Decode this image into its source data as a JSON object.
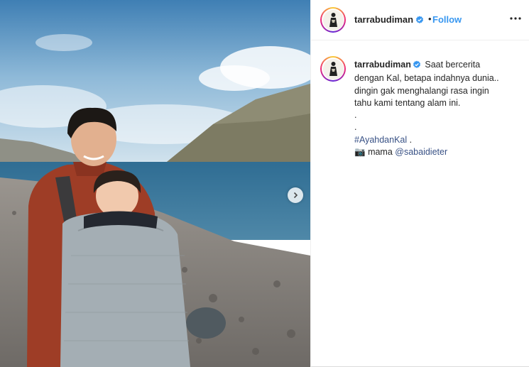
{
  "post": {
    "account": {
      "username": "tarrabudiman",
      "verified": true,
      "follow_label": "Follow",
      "separator": "•"
    },
    "more_icon": "more-options-icon",
    "carousel_icon": "chevron-right-icon",
    "caption": {
      "username": "tarrabudiman",
      "lines": [
        "Saat bercerita",
        "dengan Kal, betapa indahnya dunia..",
        "dingin gak menghalangi rasa ingin",
        "tahu kami tentang alam ini.",
        ".",
        "."
      ],
      "hashtag": "#AyahdanKal",
      "hashtag_suffix": " .",
      "camera_emoji": "📷",
      "credit_prefix": "mama",
      "credit_mention": "@sabaidieter"
    }
  },
  "colors": {
    "link_blue": "#3897f0",
    "tag_blue": "#385185",
    "verified_blue": "#3897f0",
    "text": "#262626",
    "border": "#efefef"
  }
}
